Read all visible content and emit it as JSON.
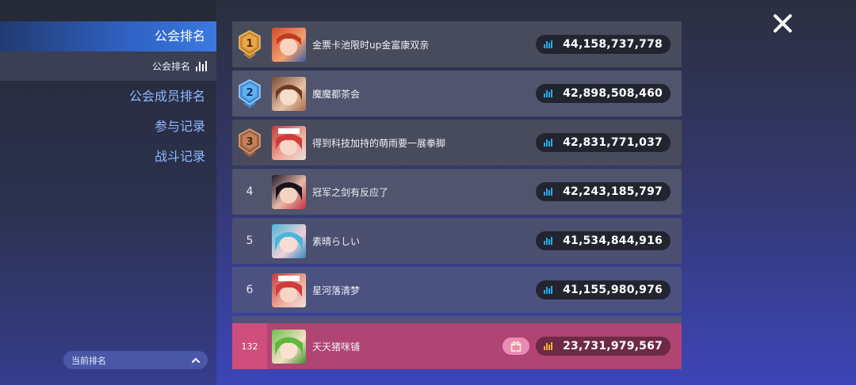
{
  "sidebar": {
    "active_tab": "公会排名",
    "sub_tab": "公会排名",
    "items": [
      {
        "label": "公会成员排名"
      },
      {
        "label": "参与记录"
      },
      {
        "label": "战斗记录"
      }
    ],
    "current_rank_label": "当前排名"
  },
  "rankings": [
    {
      "rank": "1",
      "name": "金票卡池限时up金富康双亲",
      "score": "44,158,737,778"
    },
    {
      "rank": "2",
      "name": "魔魔都茶会",
      "score": "42,898,508,460"
    },
    {
      "rank": "3",
      "name": "得到科技加持的萌雨要一展拳脚",
      "score": "42,831,771,037"
    },
    {
      "rank": "4",
      "name": "冠军之剑有反应了",
      "score": "42,243,185,797"
    },
    {
      "rank": "5",
      "name": "素晴らしい",
      "score": "41,534,844,916"
    },
    {
      "rank": "6",
      "name": "星河落清梦",
      "score": "41,155,980,976"
    }
  ],
  "my_guild": {
    "rank": "132",
    "name": "天天猪咪铺",
    "score": "23,731,979,567"
  },
  "colors": {
    "gold": "#c9852e",
    "silver_blue": "#3f8fd6",
    "bronze": "#a0623e",
    "highlight_row": "#b04472",
    "stat_blue": "#29a9e8",
    "stat_gold": "#f0b43a"
  },
  "icons": {
    "close": "close-icon",
    "stat": "bar-chart-icon",
    "gift": "gift-icon",
    "caret": "chevron-up-icon"
  }
}
